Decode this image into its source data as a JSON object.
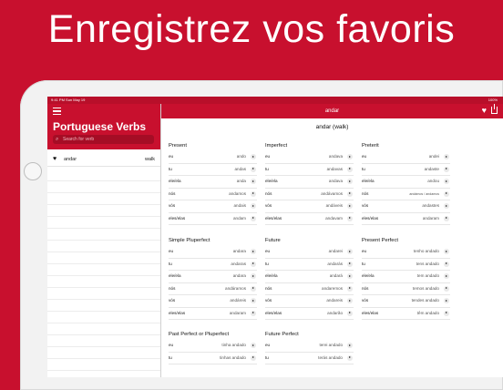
{
  "headline": "Enregistrez vos favoris",
  "status": {
    "time": "9:41 PM",
    "date": "Sun May 19",
    "battery": "100%"
  },
  "sidebar": {
    "title": "Portuguese Verbs",
    "search_placeholder": "Search for verb",
    "items": [
      {
        "verb": "andar",
        "translation": "walk"
      }
    ]
  },
  "main": {
    "title": "andar",
    "verb_header": "andar (walk)",
    "tenses": [
      {
        "title": "Present",
        "forms": [
          {
            "pronoun": "eu",
            "form": "ando"
          },
          {
            "pronoun": "tu",
            "form": "andas"
          },
          {
            "pronoun": "ele/ela",
            "form": "anda"
          },
          {
            "pronoun": "nós",
            "form": "andamos"
          },
          {
            "pronoun": "vós",
            "form": "andais"
          },
          {
            "pronoun": "eles/elas",
            "form": "andam"
          }
        ]
      },
      {
        "title": "Imperfect",
        "forms": [
          {
            "pronoun": "eu",
            "form": "andava"
          },
          {
            "pronoun": "tu",
            "form": "andavas"
          },
          {
            "pronoun": "ele/ela",
            "form": "andava"
          },
          {
            "pronoun": "nós",
            "form": "andávamos"
          },
          {
            "pronoun": "vós",
            "form": "andáveis"
          },
          {
            "pronoun": "eles/elas",
            "form": "andavam"
          }
        ]
      },
      {
        "title": "Preterit",
        "forms": [
          {
            "pronoun": "eu",
            "form": "andei"
          },
          {
            "pronoun": "tu",
            "form": "andaste"
          },
          {
            "pronoun": "ele/ela",
            "form": "andou"
          },
          {
            "pronoun": "nós",
            "form": "andámos / andamos"
          },
          {
            "pronoun": "vós",
            "form": "andastes"
          },
          {
            "pronoun": "eles/elas",
            "form": "andaram"
          }
        ]
      },
      {
        "title": "Simple Pluperfect",
        "forms": [
          {
            "pronoun": "eu",
            "form": "andara"
          },
          {
            "pronoun": "tu",
            "form": "andaras"
          },
          {
            "pronoun": "ele/ela",
            "form": "andara"
          },
          {
            "pronoun": "nós",
            "form": "andáramos"
          },
          {
            "pronoun": "vós",
            "form": "andáreis"
          },
          {
            "pronoun": "eles/elas",
            "form": "andaram"
          }
        ]
      },
      {
        "title": "Future",
        "forms": [
          {
            "pronoun": "eu",
            "form": "andarei"
          },
          {
            "pronoun": "tu",
            "form": "andarás"
          },
          {
            "pronoun": "ele/ela",
            "form": "andará"
          },
          {
            "pronoun": "nós",
            "form": "andaremos"
          },
          {
            "pronoun": "vós",
            "form": "andareis"
          },
          {
            "pronoun": "eles/elas",
            "form": "andarão"
          }
        ]
      },
      {
        "title": "Present Perfect",
        "forms": [
          {
            "pronoun": "eu",
            "form": "tenho andado"
          },
          {
            "pronoun": "tu",
            "form": "tens andado"
          },
          {
            "pronoun": "ele/ela",
            "form": "tem andado"
          },
          {
            "pronoun": "nós",
            "form": "temos andado"
          },
          {
            "pronoun": "vós",
            "form": "tendes andado"
          },
          {
            "pronoun": "eles/elas",
            "form": "têm andado"
          }
        ]
      },
      {
        "title": "Past Perfect or Pluperfect",
        "forms": [
          {
            "pronoun": "eu",
            "form": "tinha andado"
          },
          {
            "pronoun": "tu",
            "form": "tinhas andado"
          }
        ]
      },
      {
        "title": "Future Perfect",
        "forms": [
          {
            "pronoun": "eu",
            "form": "terei andado"
          },
          {
            "pronoun": "tu",
            "form": "terás andado"
          }
        ]
      }
    ]
  },
  "colors": {
    "brand": "#c8102e",
    "brand_dark": "#a50d25"
  },
  "icons": [
    "hamburger-icon",
    "search-icon",
    "heart-icon",
    "share-icon",
    "play-icon"
  ]
}
